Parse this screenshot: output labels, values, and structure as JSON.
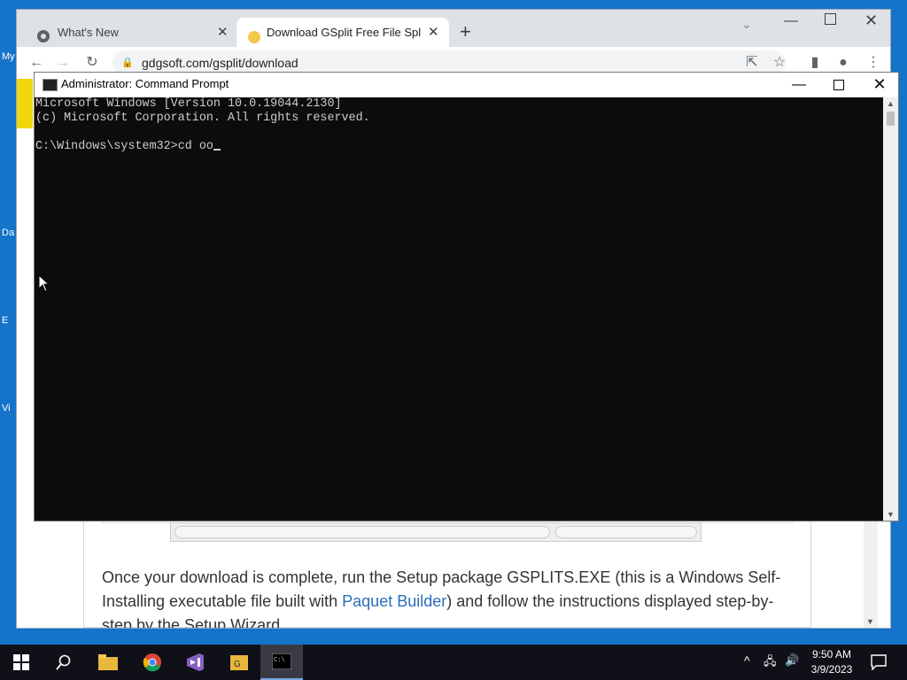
{
  "desktop": {
    "icons": [
      "My",
      "Da",
      "E",
      "Vi"
    ]
  },
  "browser": {
    "tabs": [
      {
        "title": "What's New",
        "icon": "chrome-icon"
      },
      {
        "title": "Download GSplit Free File Splitte",
        "icon": "gsplit-favicon"
      }
    ],
    "new_tab": "+",
    "url": "gdgsoft.com/gsplit/download",
    "content": {
      "para_before": "Once your download is complete, run the Setup package GSPLITS.EXE (this is a Windows Self-Installing executable file built with ",
      "link": "Paquet Builder",
      "para_after": ") and follow the instructions displayed step-by-step by the Setup Wizard."
    }
  },
  "cmd": {
    "title": "Administrator: Command Prompt",
    "lines": [
      "Microsoft Windows [Version 10.0.19044.2130]",
      "(c) Microsoft Corporation. All rights reserved.",
      "",
      "C:\\Windows\\system32>cd oo"
    ]
  },
  "taskbar": {
    "time": "9:50 AM",
    "date": "3/9/2023",
    "apps": [
      "start-icon",
      "search-icon",
      "file-explorer-icon",
      "chrome-icon",
      "visual-studio-icon",
      "gsplit-icon",
      "cmd-icon"
    ]
  },
  "colors": {
    "desktop": "#1573c9",
    "taskbar": "#101018",
    "cmd_bg": "#0c0c0c",
    "link": "#2a6ebb"
  }
}
